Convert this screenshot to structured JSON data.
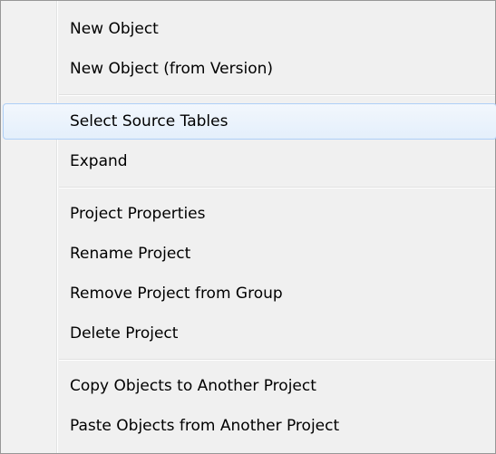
{
  "context_menu": {
    "groups": [
      {
        "items": [
          {
            "label": "New Object"
          },
          {
            "label": "New Object (from Version)"
          }
        ]
      },
      {
        "items": [
          {
            "label": "Select Source Tables",
            "highlighted": true
          },
          {
            "label": "Expand"
          }
        ]
      },
      {
        "items": [
          {
            "label": "Project Properties"
          },
          {
            "label": "Rename Project"
          },
          {
            "label": "Remove Project from Group"
          },
          {
            "label": "Delete Project"
          }
        ]
      },
      {
        "items": [
          {
            "label": "Copy Objects to Another Project"
          },
          {
            "label": "Paste Objects from Another Project"
          }
        ]
      }
    ],
    "colors": {
      "background": "#f0f0f0",
      "border": "#979797",
      "highlight_border": "#aecff7",
      "highlight_fill": "#e8f1fb"
    }
  }
}
